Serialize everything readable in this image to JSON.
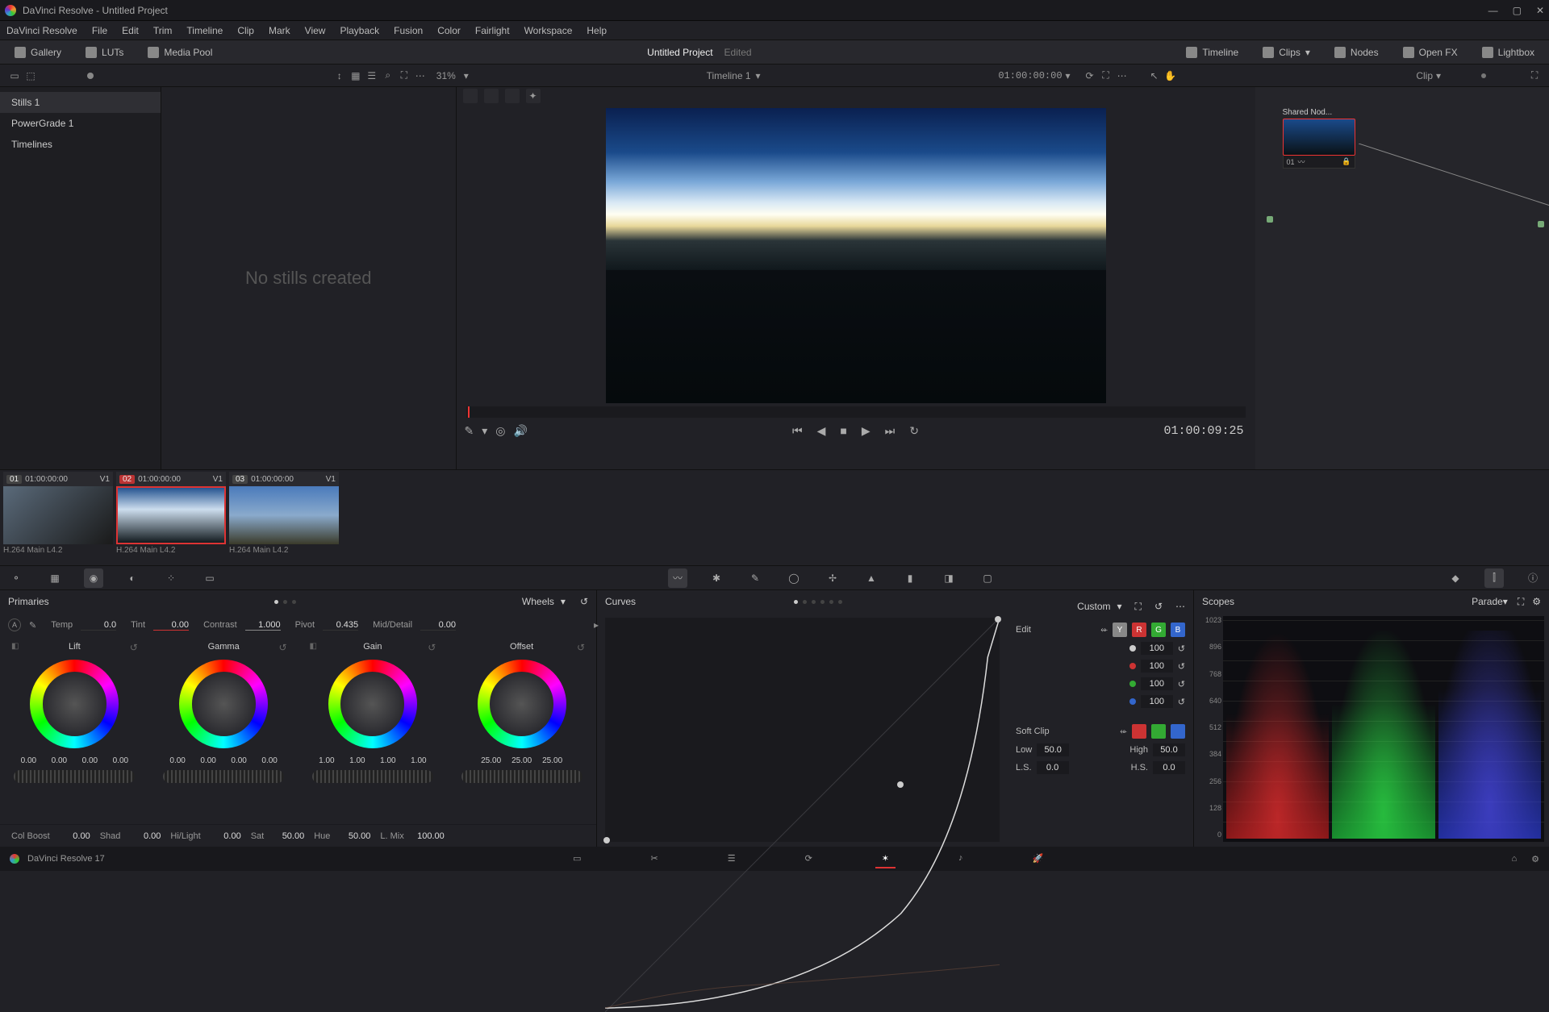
{
  "title": "DaVinci Resolve - Untitled Project",
  "menubar": [
    "DaVinci Resolve",
    "File",
    "Edit",
    "Trim",
    "Timeline",
    "Clip",
    "Mark",
    "View",
    "Playback",
    "Fusion",
    "Color",
    "Fairlight",
    "Workspace",
    "Help"
  ],
  "toolbar": {
    "gallery": "Gallery",
    "luts": "LUTs",
    "mediapool": "Media Pool",
    "project": "Untitled Project",
    "edited": "Edited",
    "timeline": "Timeline",
    "clips": "Clips",
    "nodes": "Nodes",
    "openfx": "Open FX",
    "lightbox": "Lightbox"
  },
  "secondrow": {
    "zoom": "31%",
    "timeline_name": "Timeline 1",
    "timecode_in": "01:00:00:00",
    "node_mode": "Clip"
  },
  "gallery": {
    "stills": "Stills 1",
    "powergrade": "PowerGrade 1",
    "timelines": "Timelines",
    "empty": "No stills created"
  },
  "node": {
    "label": "Shared Nod...",
    "num": "01"
  },
  "transport_tc": "01:00:09:25",
  "clips": [
    {
      "num": "01",
      "tc": "01:00:00:00",
      "track": "V1",
      "codec": "H.264 Main L4.2"
    },
    {
      "num": "02",
      "tc": "01:00:00:00",
      "track": "V1",
      "codec": "H.264 Main L4.2"
    },
    {
      "num": "03",
      "tc": "01:00:00:00",
      "track": "V1",
      "codec": "H.264 Main L4.2"
    }
  ],
  "primaries": {
    "title": "Primaries",
    "mode": "Wheels",
    "temp": {
      "lbl": "Temp",
      "val": "0.0"
    },
    "tint": {
      "lbl": "Tint",
      "val": "0.00"
    },
    "contrast": {
      "lbl": "Contrast",
      "val": "1.000"
    },
    "pivot": {
      "lbl": "Pivot",
      "val": "0.435"
    },
    "mid": {
      "lbl": "Mid/Detail",
      "val": "0.00"
    },
    "wheels": {
      "lift": {
        "name": "Lift",
        "vals": [
          "0.00",
          "0.00",
          "0.00",
          "0.00"
        ]
      },
      "gamma": {
        "name": "Gamma",
        "vals": [
          "0.00",
          "0.00",
          "0.00",
          "0.00"
        ]
      },
      "gain": {
        "name": "Gain",
        "vals": [
          "1.00",
          "1.00",
          "1.00",
          "1.00"
        ]
      },
      "offset": {
        "name": "Offset",
        "vals": [
          "25.00",
          "25.00",
          "25.00"
        ]
      }
    },
    "bottom": {
      "colboost": {
        "lbl": "Col Boost",
        "val": "0.00"
      },
      "shad": {
        "lbl": "Shad",
        "val": "0.00"
      },
      "hilight": {
        "lbl": "Hi/Light",
        "val": "0.00"
      },
      "sat": {
        "lbl": "Sat",
        "val": "50.00"
      },
      "hue": {
        "lbl": "Hue",
        "val": "50.00"
      },
      "lmix": {
        "lbl": "L. Mix",
        "val": "100.00"
      }
    }
  },
  "curves": {
    "title": "Curves",
    "mode": "Custom",
    "edit": "Edit",
    "channels": {
      "y": "Y",
      "r": "R",
      "g": "G",
      "b": "B"
    },
    "vals": {
      "y": "100",
      "r": "100",
      "g": "100",
      "b": "100"
    },
    "softclip": "Soft Clip",
    "low": {
      "lbl": "Low",
      "val": "50.0"
    },
    "high": {
      "lbl": "High",
      "val": "50.0"
    },
    "ls": {
      "lbl": "L.S.",
      "val": "0.0"
    },
    "hs": {
      "lbl": "H.S.",
      "val": "0.0"
    }
  },
  "scopes": {
    "title": "Scopes",
    "mode": "Parade",
    "ticks": [
      "1023",
      "896",
      "768",
      "640",
      "512",
      "384",
      "256",
      "128",
      "0"
    ]
  },
  "footer": {
    "app": "DaVinci Resolve 17"
  }
}
